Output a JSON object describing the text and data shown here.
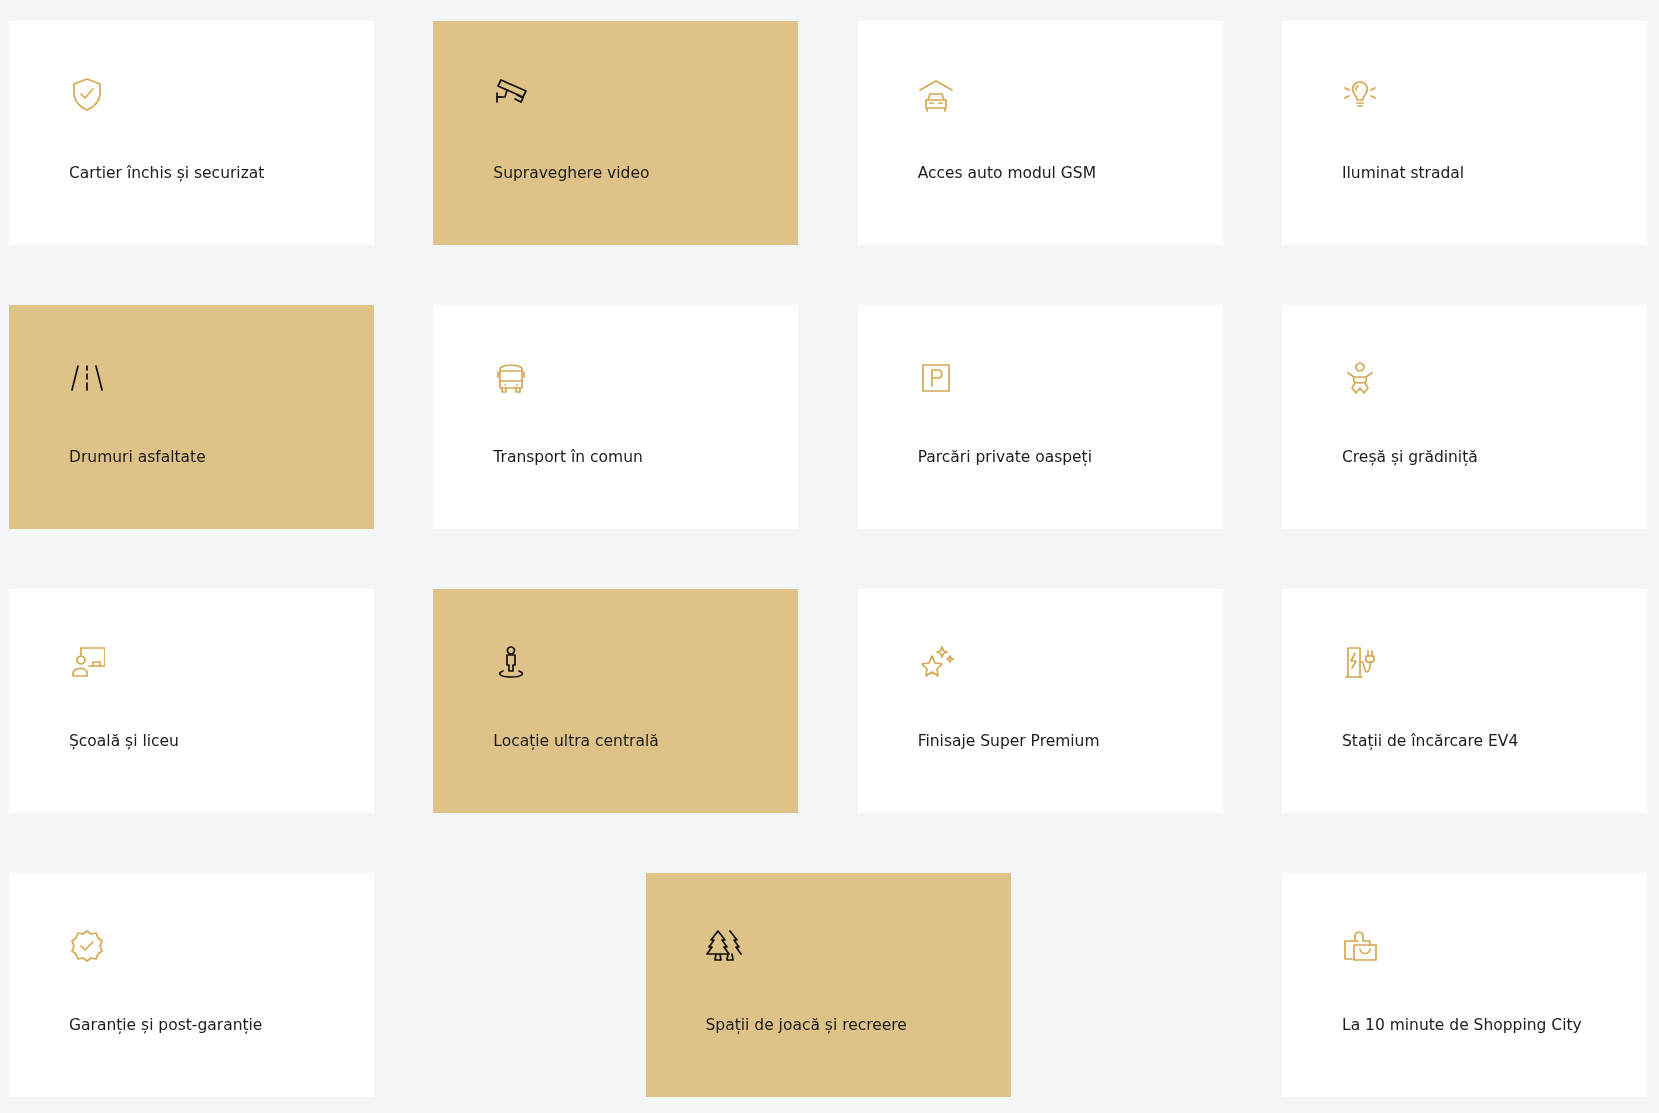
{
  "rows": [
    {
      "cards": [
        {
          "kind": "shield",
          "label": "Cartier închis și securizat",
          "highlighted": false
        },
        {
          "kind": "camera",
          "label": "Supraveghere video",
          "highlighted": true
        },
        {
          "kind": "garage",
          "label": "Acces auto modul GSM",
          "highlighted": false
        },
        {
          "kind": "bulb",
          "label": "Iluminat stradal",
          "highlighted": false
        }
      ]
    },
    {
      "cards": [
        {
          "kind": "road",
          "label": "Drumuri asfaltate",
          "highlighted": true
        },
        {
          "kind": "bus",
          "label": "Transport în comun",
          "highlighted": false
        },
        {
          "kind": "parking",
          "label": "Parcări private oaspeți",
          "highlighted": false
        },
        {
          "kind": "baby",
          "label": "Creșă și grădiniță",
          "highlighted": false
        }
      ]
    },
    {
      "cards": [
        {
          "kind": "school",
          "label": "Școală și liceu",
          "highlighted": false
        },
        {
          "kind": "location",
          "label": "Locație ultra centrală",
          "highlighted": true
        },
        {
          "kind": "stars",
          "label": "Finisaje Super Premium",
          "highlighted": false
        },
        {
          "kind": "charger",
          "label": "Stații de încărcare EV4",
          "highlighted": false
        }
      ]
    },
    {
      "cards": [
        {
          "kind": "badge",
          "label": "Garanție și post-garanție",
          "highlighted": false
        },
        {
          "kind": "trees",
          "label": "Spații de joacă și recreere",
          "highlighted": true
        },
        {
          "kind": "bag",
          "label": "La 10 minute de Shopping City",
          "highlighted": false
        }
      ]
    }
  ]
}
